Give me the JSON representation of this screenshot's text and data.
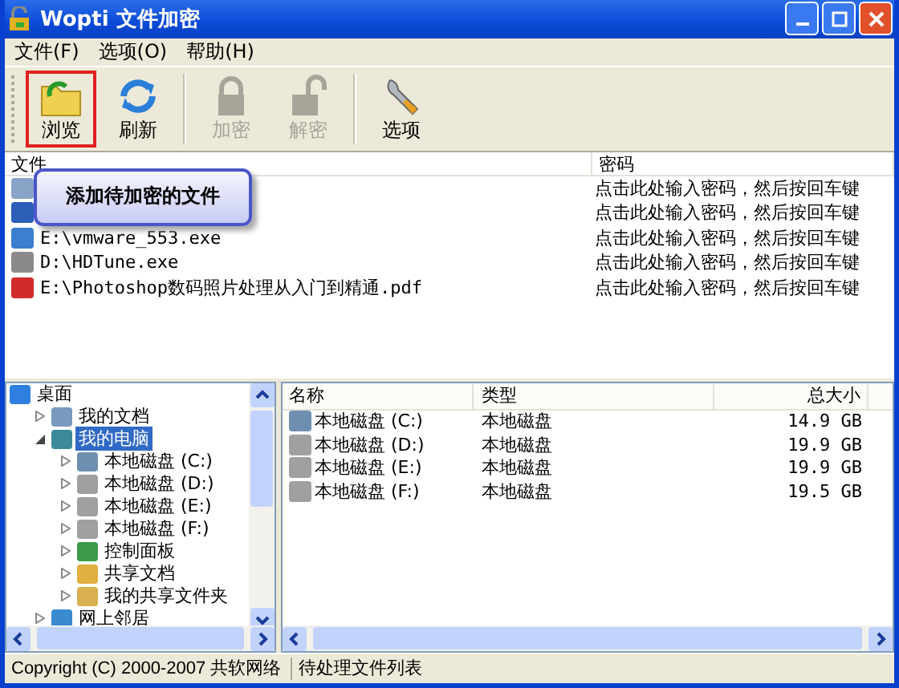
{
  "window": {
    "title": "Wopti 文件加密"
  },
  "menu": [
    {
      "label": "文件(F)"
    },
    {
      "label": "选项(O)"
    },
    {
      "label": "帮助(H)"
    }
  ],
  "toolbar": [
    {
      "label": "浏览",
      "kind": "browse",
      "disabled": false,
      "highlighted": true
    },
    {
      "label": "刷新",
      "kind": "refresh",
      "disabled": false,
      "highlighted": false
    },
    {
      "label": "加密",
      "kind": "lock",
      "disabled": true,
      "highlighted": false
    },
    {
      "label": "解密",
      "kind": "unlock",
      "disabled": true,
      "highlighted": false
    },
    {
      "label": "选项",
      "kind": "wrench",
      "disabled": false,
      "highlighted": false
    }
  ],
  "tooltip": {
    "text": "添加待加密的文件"
  },
  "file_list": {
    "columns": [
      "文件",
      "密码"
    ],
    "rows": [
      {
        "kind": "recycle",
        "password": "点击此处输入密码，然后按回车键"
      },
      {
        "kind": "doc",
        "password": "点击此处输入密码，然后按回车键"
      },
      {
        "kind": "exe",
        "file": "E:\\vmware_553.exe",
        "password": "点击此处输入密码，然后按回车键"
      },
      {
        "kind": "disk",
        "file": "D:\\HDTune.exe",
        "password": "点击此处输入密码，然后按回车键"
      },
      {
        "kind": "pdf",
        "file": "E:\\Photoshop数码照片处理从入门到精通.pdf",
        "password": "点击此处输入密码，然后按回车键"
      }
    ]
  },
  "tree": [
    {
      "label": "桌面",
      "kind": "desktop",
      "selected": false,
      "children": [
        {
          "label": "我的文档",
          "kind": "docs",
          "expanded": false,
          "selected": false
        },
        {
          "label": "我的电脑",
          "kind": "computer",
          "expanded": true,
          "selected": true,
          "children": [
            {
              "label": "本地磁盘  (C:)",
              "kind": "sysdrive",
              "expanded": false,
              "selected": false
            },
            {
              "label": "本地磁盘  (D:)",
              "kind": "drive",
              "expanded": false,
              "selected": false
            },
            {
              "label": "本地磁盘  (E:)",
              "kind": "drive",
              "expanded": false,
              "selected": false
            },
            {
              "label": "本地磁盘  (F:)",
              "kind": "drive",
              "expanded": false,
              "selected": false
            },
            {
              "label": "控制面板",
              "kind": "control",
              "expanded": false,
              "selected": false
            },
            {
              "label": "共享文档",
              "kind": "folder",
              "expanded": false,
              "selected": false
            },
            {
              "label": "我的共享文件夹",
              "kind": "share",
              "expanded": false,
              "selected": false
            }
          ]
        },
        {
          "label": "网上邻居",
          "kind": "network",
          "expanded": false,
          "selected": false
        }
      ]
    }
  ],
  "drive_list": {
    "columns": [
      "名称",
      "类型",
      "总大小"
    ],
    "rows": [
      {
        "kind": "sysdrive",
        "name": "本地磁盘  (C:)",
        "type": "本地磁盘",
        "size": "14.9 GB"
      },
      {
        "kind": "drive",
        "name": "本地磁盘  (D:)",
        "type": "本地磁盘",
        "size": "19.9 GB"
      },
      {
        "kind": "drive",
        "name": "本地磁盘  (E:)",
        "type": "本地磁盘",
        "size": "19.9 GB"
      },
      {
        "kind": "drive",
        "name": "本地磁盘  (F:)",
        "type": "本地磁盘",
        "size": "19.5 GB"
      }
    ]
  },
  "status_bar": [
    "Copyright (C) 2000-2007 共软网络",
    "待处理文件列表"
  ]
}
